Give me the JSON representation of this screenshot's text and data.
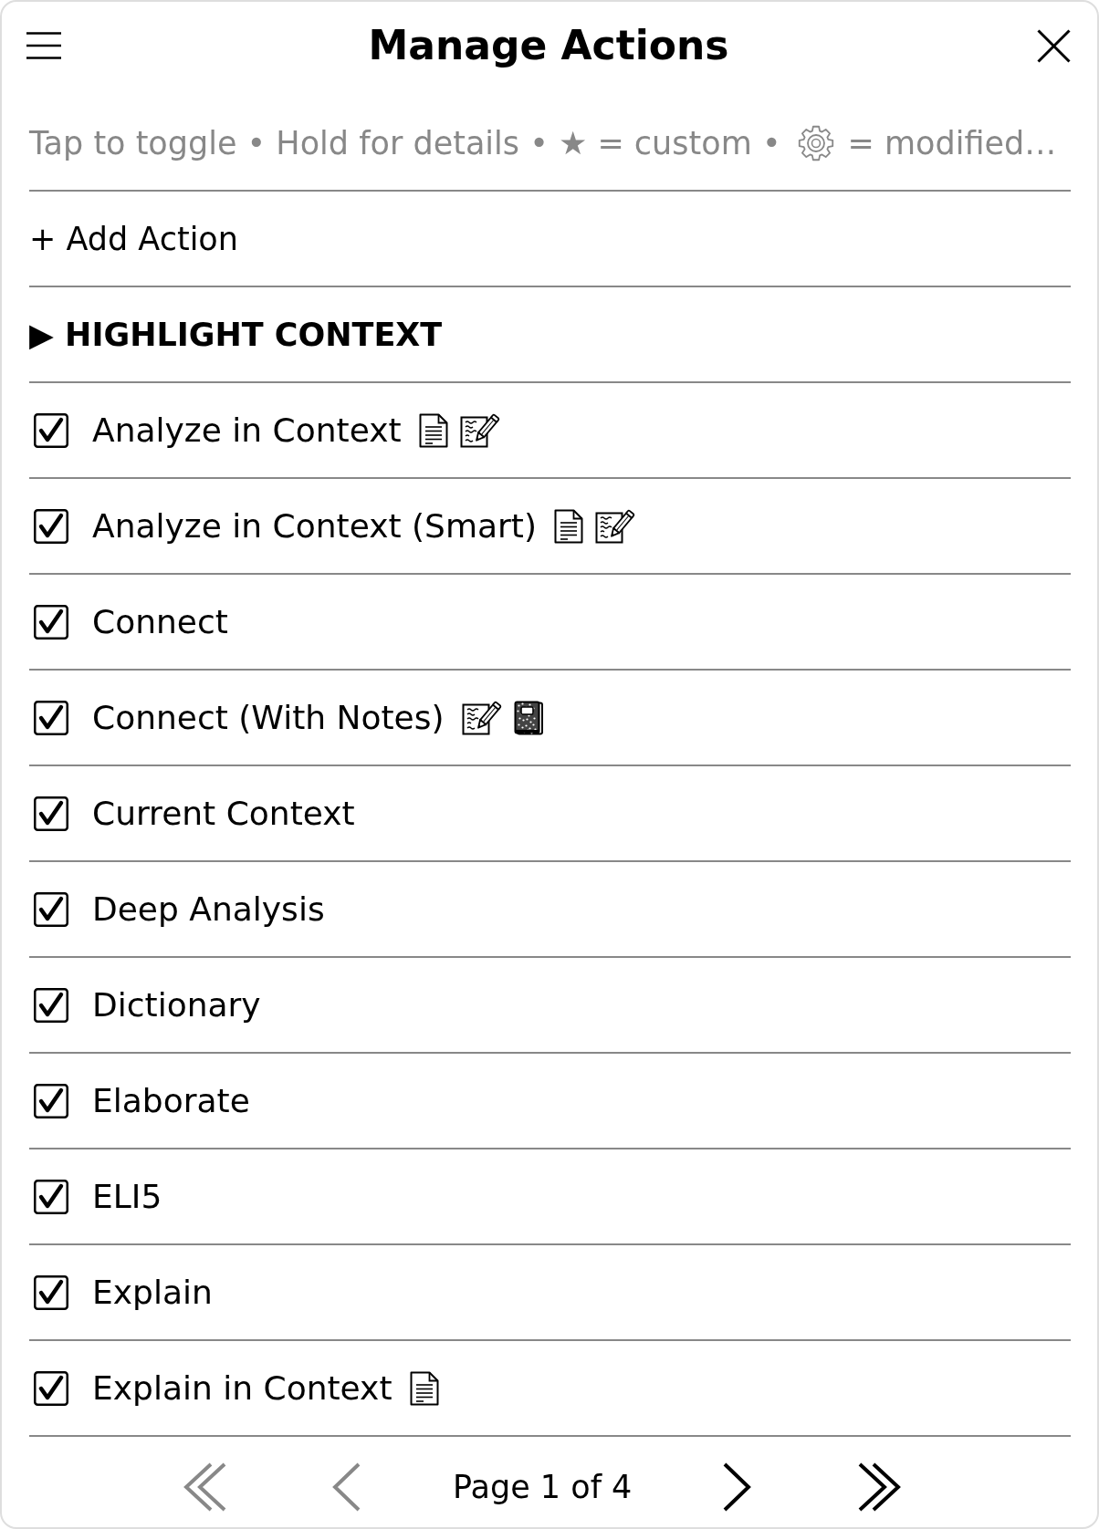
{
  "header": {
    "title": "Manage Actions"
  },
  "hint": {
    "text_before": "Tap to toggle • Hold for details • ★ = custom •",
    "text_after": "= modified…"
  },
  "add_button": {
    "label": "+ Add Action"
  },
  "section": {
    "title": "▶ HIGHLIGHT CONTEXT",
    "actions": [
      {
        "label": "Analyze in Context",
        "checked": true,
        "badges": [
          {
            "kind": "page"
          },
          {
            "kind": "memo"
          }
        ]
      },
      {
        "label": "Analyze in Context (Smart)",
        "checked": true,
        "badges": [
          {
            "kind": "page"
          },
          {
            "kind": "memo"
          }
        ]
      },
      {
        "label": "Connect",
        "checked": true
      },
      {
        "label": "Connect (With Notes)",
        "checked": true,
        "badges": [
          {
            "kind": "memo"
          },
          {
            "kind": "notebook"
          }
        ]
      },
      {
        "label": "Current Context",
        "checked": true
      },
      {
        "label": "Deep Analysis",
        "checked": true
      },
      {
        "label": "Dictionary",
        "checked": true
      },
      {
        "label": "Elaborate",
        "checked": true
      },
      {
        "label": "ELI5",
        "checked": true
      },
      {
        "label": "Explain",
        "checked": true
      },
      {
        "label": "Explain in Context",
        "checked": true,
        "badges": [
          {
            "kind": "page"
          }
        ]
      }
    ]
  },
  "pagination": {
    "first": {
      "disabled": true
    },
    "previous": {
      "disabled": true
    },
    "label": "Page 1 of 4",
    "next": {
      "disabled": false
    },
    "last": {
      "disabled": false
    }
  }
}
